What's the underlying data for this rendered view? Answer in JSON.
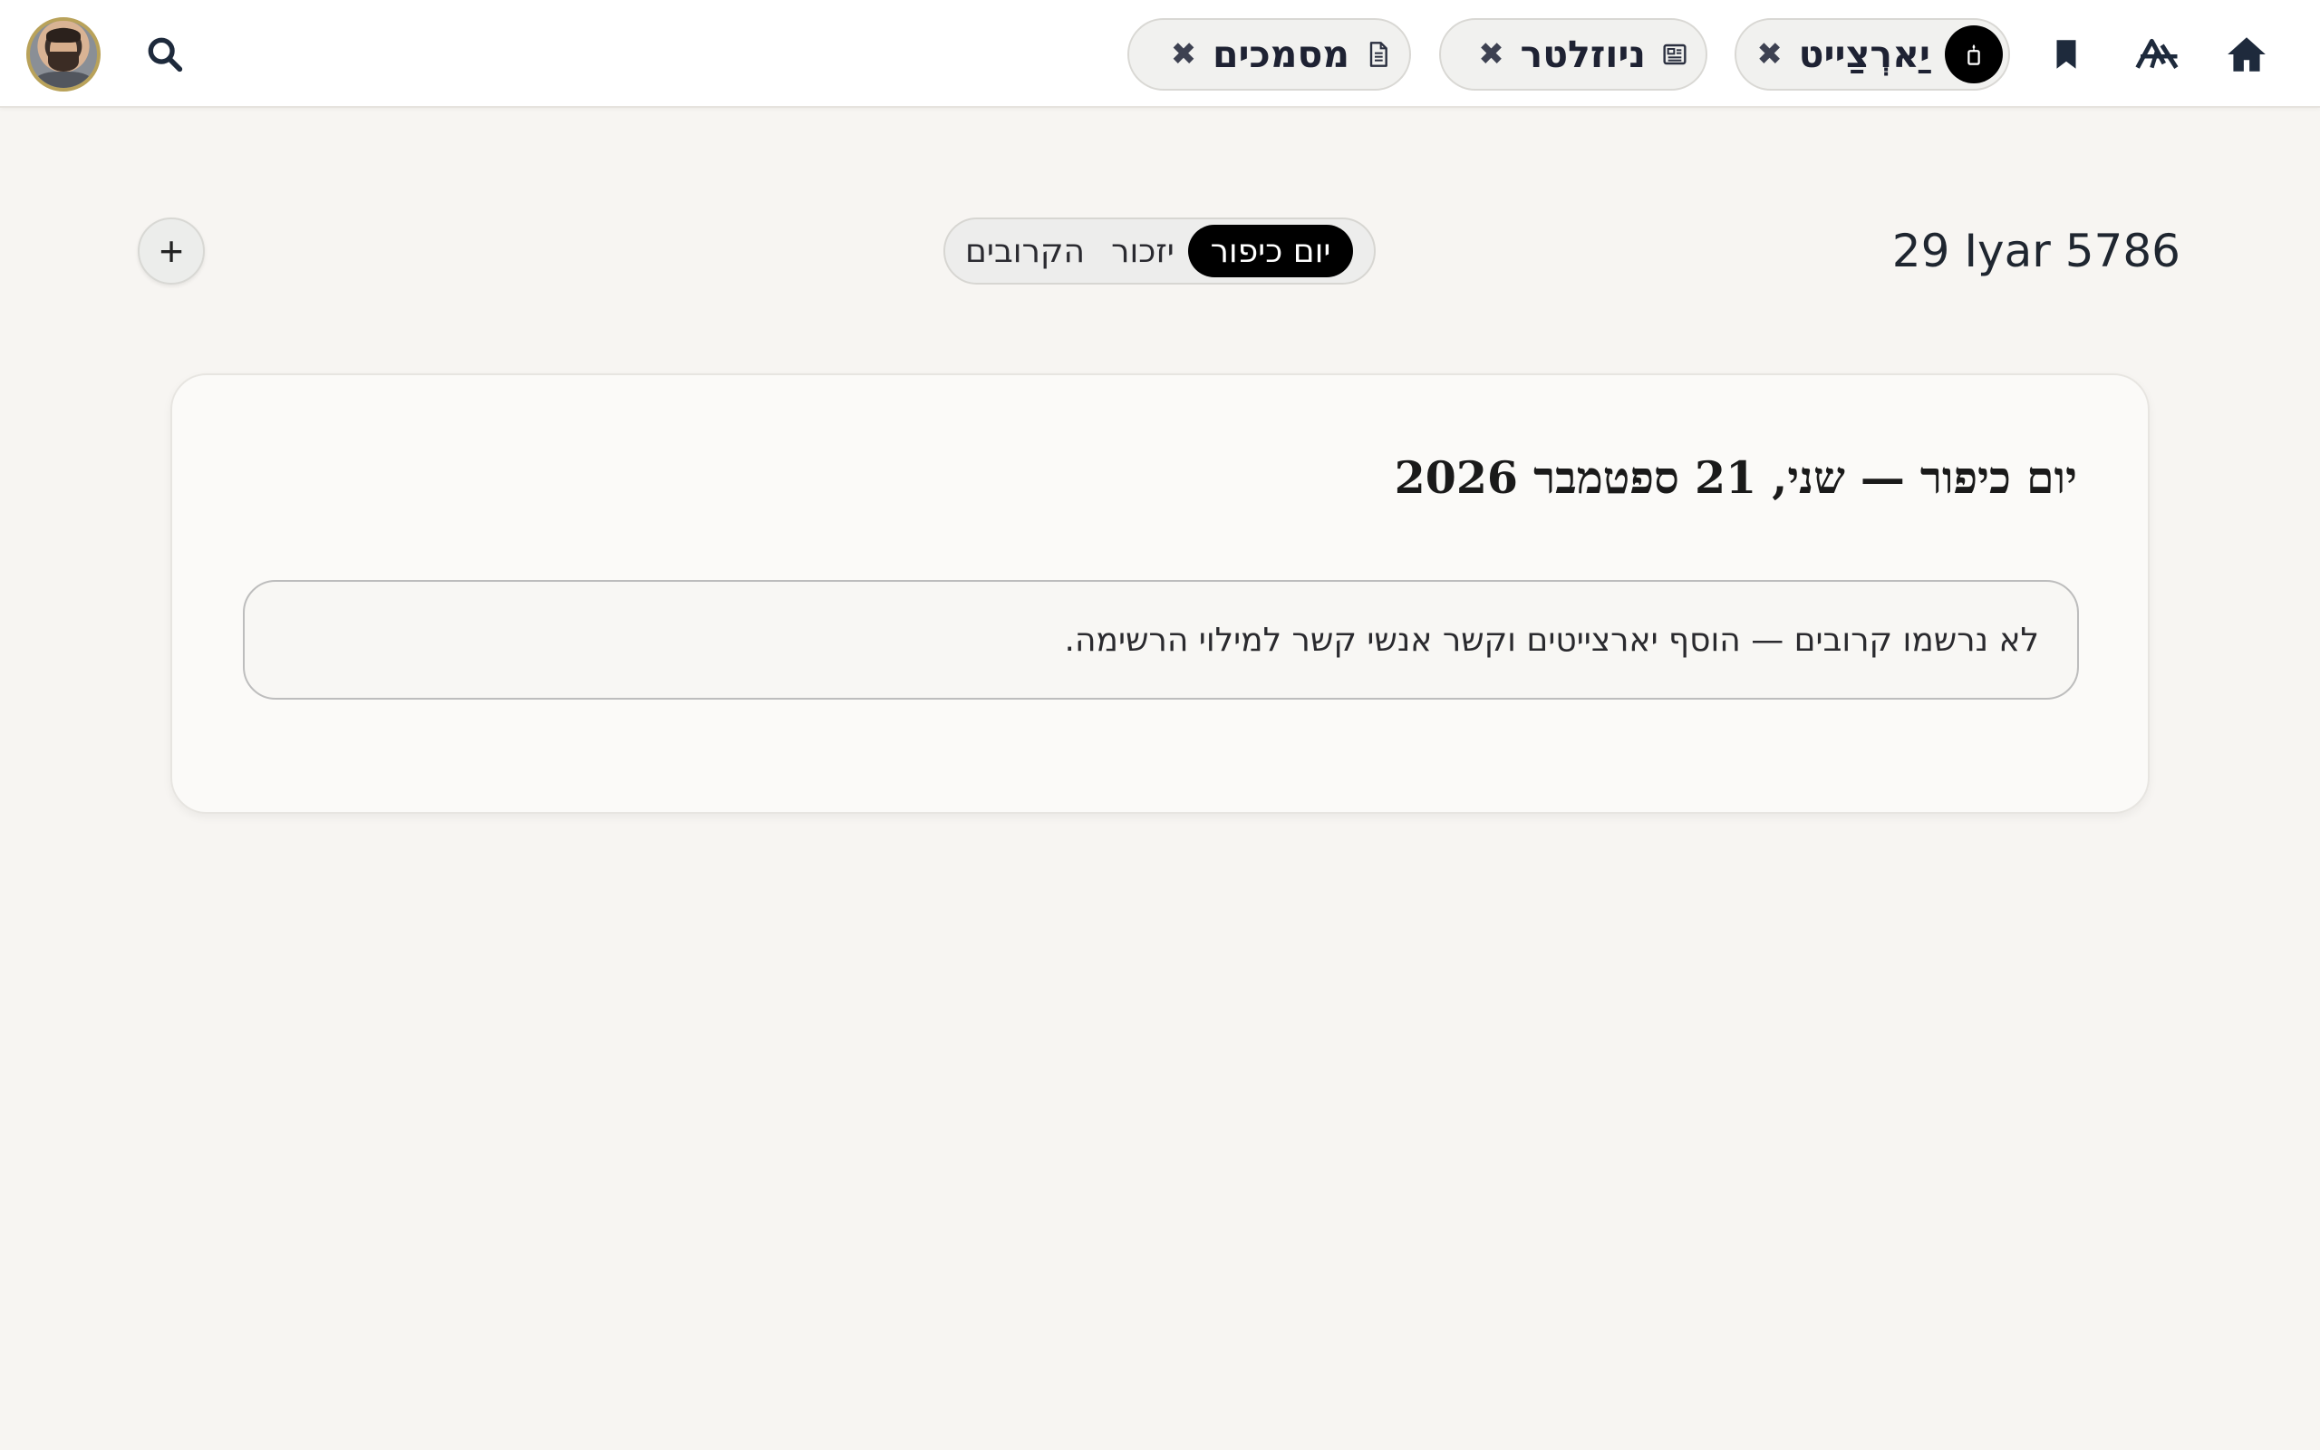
{
  "header": {
    "chips": [
      {
        "label": "יַארְצַייט",
        "icon": "candle-icon",
        "close": "✖"
      },
      {
        "label": "ניוזלטר",
        "icon": "newsletter-icon",
        "close": "✖"
      },
      {
        "label": "מסמכים",
        "icon": "document-icon",
        "close": "✖"
      }
    ],
    "nav_icons": [
      "home-icon",
      "hebrew-calendar-icon",
      "bookmark-icon",
      "search-icon"
    ]
  },
  "toolbar": {
    "add_label": "+",
    "segments": [
      {
        "label": "הקרובים"
      },
      {
        "label": "יזכור"
      },
      {
        "label": "יום כיפור",
        "selected": true
      }
    ],
    "hebrew_date": "29 Iyar 5786"
  },
  "card": {
    "title": "יום כיפור — שני, 21 ספטמבר 2026",
    "empty_message": "לא נרשמו קרובים — הוסף יארצייטים וקשר אנשי קשר למילוי הרשימה."
  },
  "colors": {
    "background": "#f7f5f2",
    "topbar": "#ffffff",
    "selected_segment": "#000000",
    "icon": "#1e2a3c"
  }
}
